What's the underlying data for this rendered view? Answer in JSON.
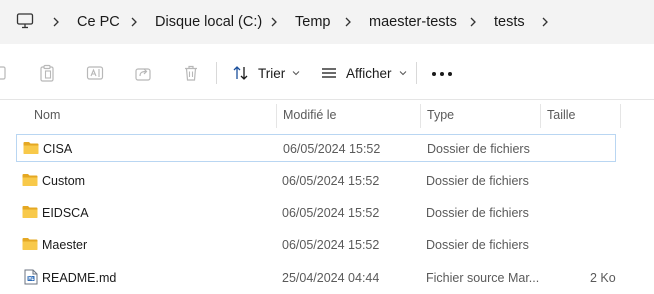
{
  "address_bar": {
    "root_icon": "computer-icon",
    "breadcrumbs": [
      "Ce PC",
      "Disque local (C:)",
      "Temp",
      "maester-tests",
      "tests"
    ],
    "separator_icon": "chevron-right-icon"
  },
  "toolbar": {
    "icons": [
      "copy-icon",
      "paste-icon",
      "rename-icon",
      "share-icon",
      "delete-icon"
    ],
    "sort_label": "Trier",
    "view_label": "Afficher",
    "more_icon": "more-options-icon"
  },
  "columns": {
    "name": "Nom",
    "modified": "Modifié le",
    "type": "Type",
    "size": "Taille"
  },
  "files": [
    {
      "name": "CISA",
      "modified": "06/05/2024 15:52",
      "type": "Dossier de fichiers",
      "size": "",
      "icon": "folder-icon",
      "selected": true
    },
    {
      "name": "Custom",
      "modified": "06/05/2024 15:52",
      "type": "Dossier de fichiers",
      "size": "",
      "icon": "folder-icon",
      "selected": false
    },
    {
      "name": "EIDSCA",
      "modified": "06/05/2024 15:52",
      "type": "Dossier de fichiers",
      "size": "",
      "icon": "folder-icon",
      "selected": false
    },
    {
      "name": "Maester",
      "modified": "06/05/2024 15:52",
      "type": "Dossier de fichiers",
      "size": "",
      "icon": "folder-icon",
      "selected": false
    },
    {
      "name": "README.md",
      "modified": "25/04/2024 04:44",
      "type": "Fichier source Mar...",
      "size": "2 Ko",
      "icon": "markdown-file-icon",
      "selected": false
    }
  ],
  "colors": {
    "folder": "#f8c94a",
    "folder_dark": "#e5a823",
    "selection_border": "#b9d6f2",
    "address_bg": "#f3f3f3"
  }
}
